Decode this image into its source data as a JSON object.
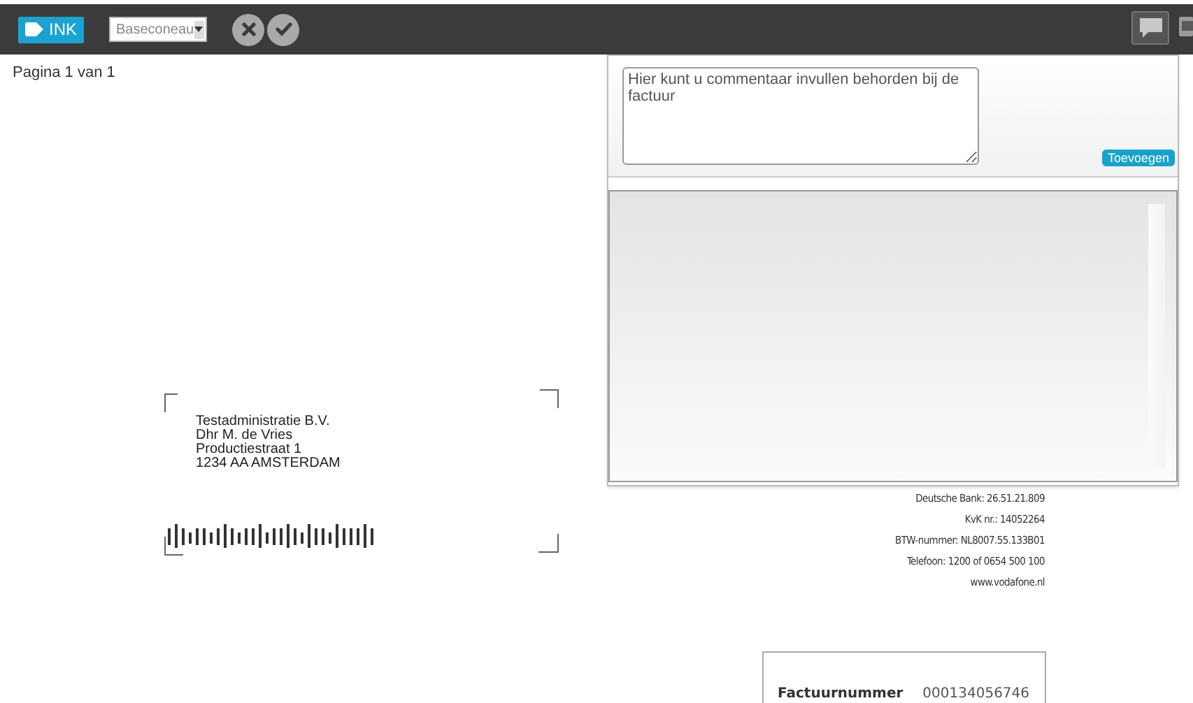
{
  "toolbar": {
    "tag_button": "INK",
    "dropdown": {
      "value": "Baseconeau"
    },
    "actions": [
      {
        "kind": "reject"
      },
      {
        "kind": "accept"
      }
    ],
    "comments_button": {
      "active": true
    }
  },
  "page_indicator": "Pagina 1 van 1",
  "document": {
    "address": [
      "Testadministratie B.V.",
      "Dhr M. de Vries",
      "Productiestraat 1",
      "1234 AA AMSTERDAM"
    ],
    "company_info": [
      "Deutsche Bank: 26.51.21.809",
      "KvK nr.: 14052264",
      "BTW-nummer: NL8007.55.133B01",
      "Telefoon: 1200 of 0654 500 100",
      "www.vodafone.nl"
    ],
    "invoice_box": {
      "label": "Factuurnummer",
      "value": "000134056746"
    }
  },
  "comment_panel": {
    "placeholder": "Hier kunt u commentaar invullen behorden bij de factuur",
    "add_button": "Toevoegen"
  }
}
